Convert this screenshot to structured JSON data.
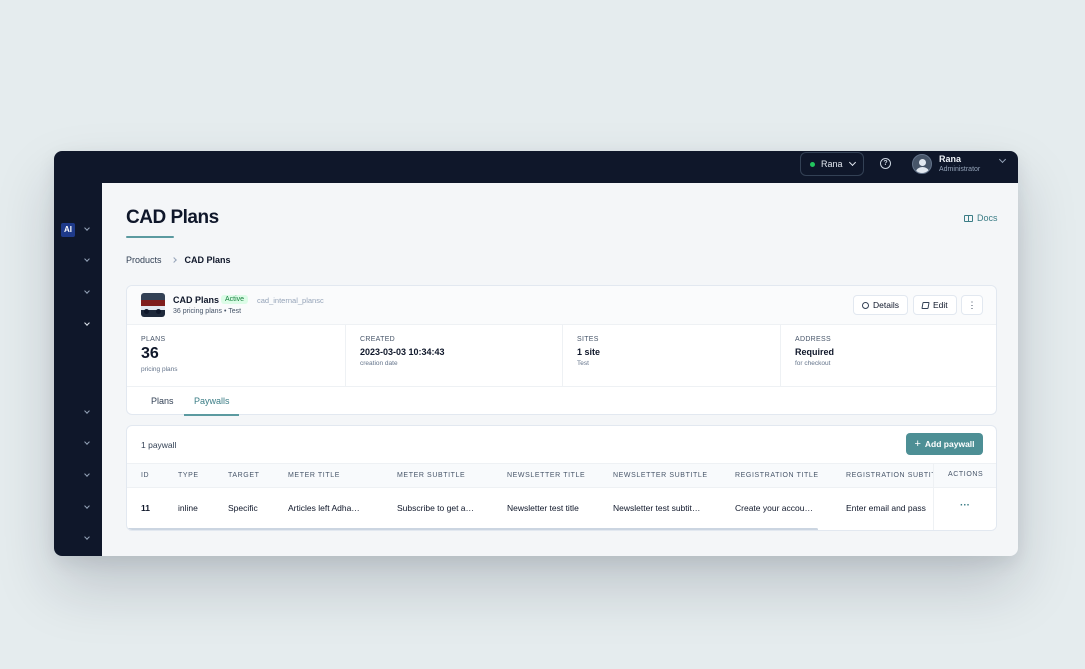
{
  "topbar": {
    "workspace": "Rana",
    "user_name": "Rana",
    "user_role": "Administrator"
  },
  "sidebar": {
    "logo": "AI"
  },
  "page": {
    "title": "CAD Plans",
    "docs_label": "Docs",
    "breadcrumb": [
      "Products",
      "CAD Plans"
    ]
  },
  "product": {
    "name": "CAD Plans",
    "status": "Active",
    "slug": "cad_internal_plansc",
    "subtitle": "36 pricing plans • Test",
    "details_label": "Details",
    "edit_label": "Edit",
    "stats": [
      {
        "label": "PLANS",
        "value": "36",
        "note": "pricing plans"
      },
      {
        "label": "CREATED",
        "value": "2023-03-03 10:34:43",
        "note": "creation date"
      },
      {
        "label": "SITES",
        "value": "1 site",
        "note": "Test"
      },
      {
        "label": "ADDRESS",
        "value": "Required",
        "note": "for checkout"
      }
    ],
    "tabs": [
      "Plans",
      "Paywalls"
    ],
    "active_tab": "Paywalls"
  },
  "paywalls": {
    "count_label": "1 paywall",
    "add_label": "Add paywall",
    "columns": [
      "ID",
      "TYPE",
      "TARGET",
      "METER TITLE",
      "METER SUBTITLE",
      "NEWSLETTER TITLE",
      "NEWSLETTER SUBTITLE",
      "REGISTRATION TITLE",
      "REGISTRATION SUBTITLE",
      "ACTIONS"
    ],
    "rows": [
      [
        "11",
        "inline",
        "Specific",
        "Articles left Adha…",
        "Subscribe to get a…",
        "Newsletter test title",
        "Newsletter test subtit…",
        "Create your accou…",
        "Enter email and pass"
      ]
    ],
    "row_menu": "···"
  },
  "colors": {
    "accent": "#4d8f95",
    "nav_bg": "#0f172a",
    "active_badge": "#15803d"
  }
}
